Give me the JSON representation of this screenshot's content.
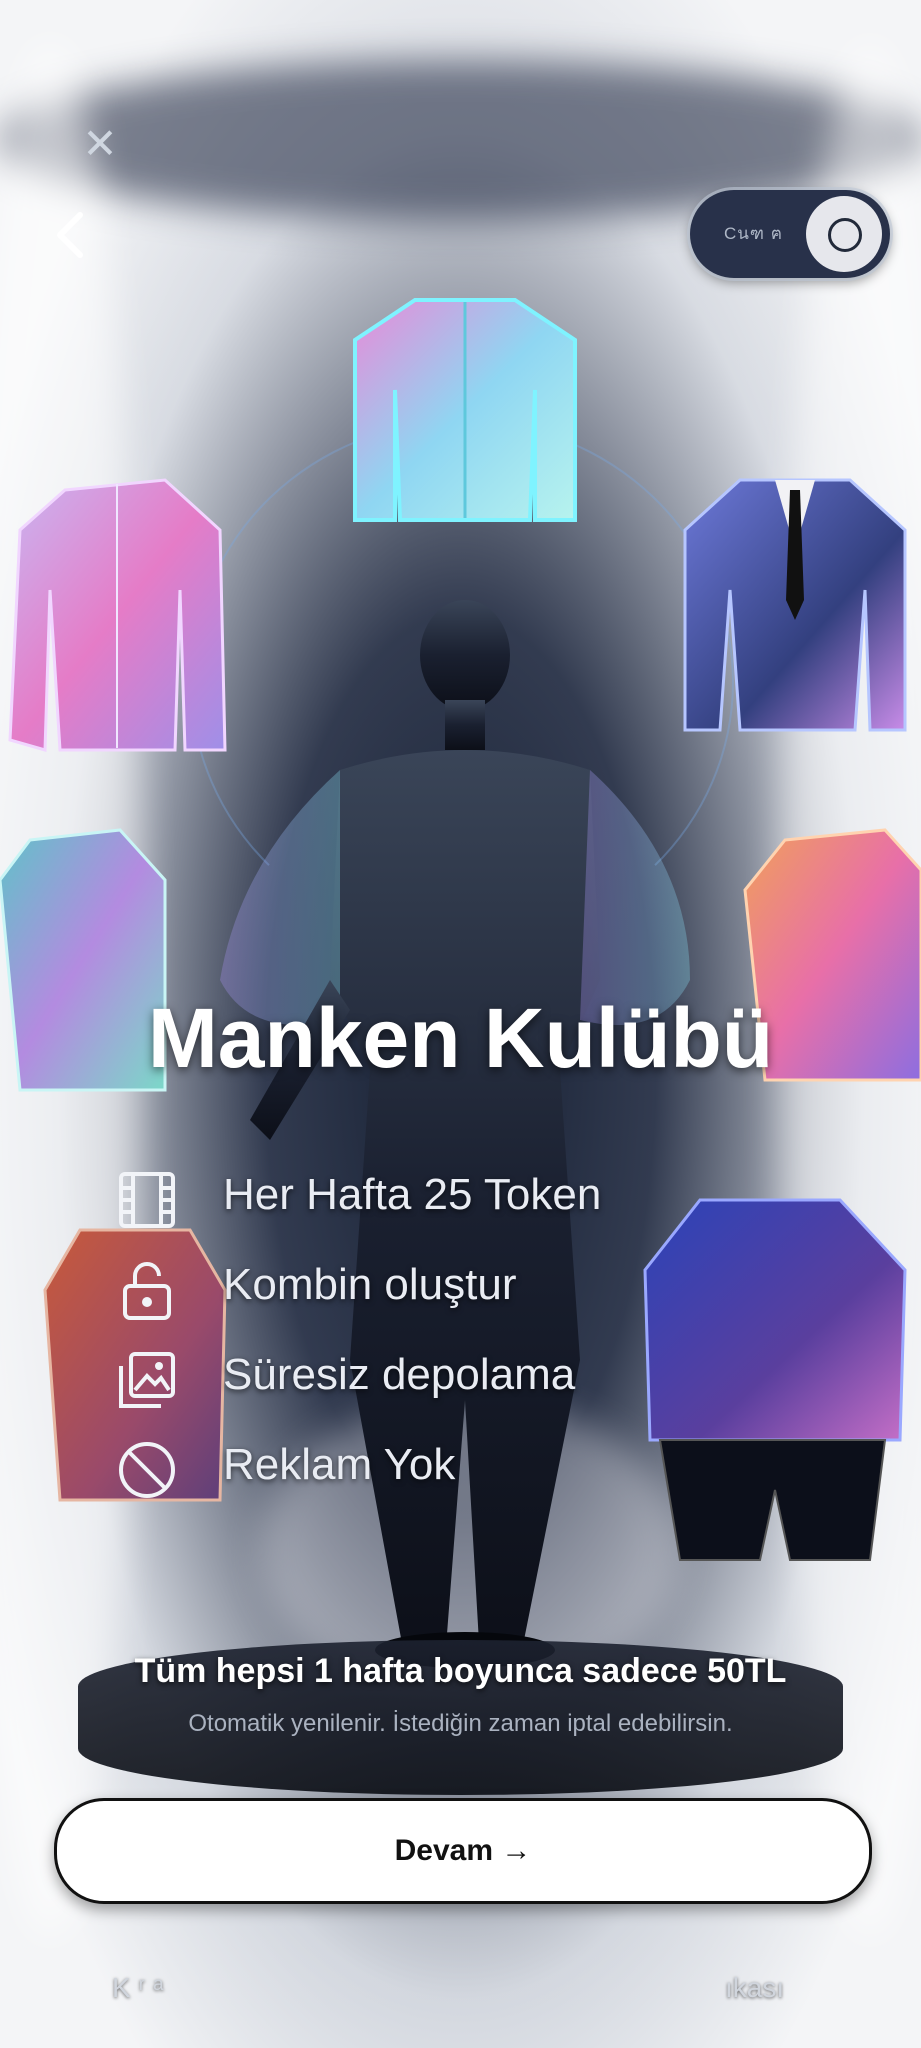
{
  "header": {
    "close_glyph": "✕",
    "toggle_label": "Cนฑ ฅ"
  },
  "hero": {
    "title": "Manken Kulübü"
  },
  "features": [
    {
      "icon": "film-icon",
      "label": "Her Hafta 25 Token"
    },
    {
      "icon": "unlock-icon",
      "label": "Kombin oluştur"
    },
    {
      "icon": "gallery-icon",
      "label": "Süresiz depolama"
    },
    {
      "icon": "no-ads-icon",
      "label": "Reklam Yok"
    }
  ],
  "pricing": {
    "headline": "Tüm hepsi 1 hafta boyunca sadece 50TL",
    "subtext": "Otomatik yenilenir. İstediğin zaman iptal edebilirsin."
  },
  "cta": {
    "label": "Devam →"
  },
  "footer": {
    "left_link": "K ʳ ᵃ",
    "right_link": "ıkası"
  },
  "colors": {
    "accent_dark": "#28314a",
    "button_bg": "#ffffff",
    "text_light": "#e9ecf3"
  }
}
